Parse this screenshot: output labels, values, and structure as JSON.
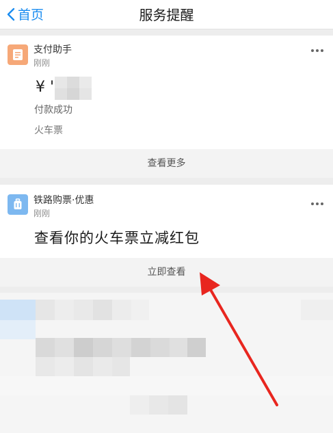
{
  "header": {
    "back_label": "首页",
    "title": "服务提醒"
  },
  "notifications": [
    {
      "app_name": "支付助手",
      "time": "刚刚",
      "amount_prefix": "¥ '",
      "status": "付款成功",
      "category": "火车票",
      "action_label": "查看更多",
      "icon": "document-icon",
      "icon_color": "#f6a878"
    },
    {
      "app_name": "铁路购票·优惠",
      "time": "刚刚",
      "message": "查看你的火车票立减红包",
      "action_label": "立即查看",
      "icon": "luggage-icon",
      "icon_color": "#7db8f0"
    }
  ],
  "colors": {
    "accent": "#1a8cf0",
    "annotation_arrow": "#e8261f"
  }
}
